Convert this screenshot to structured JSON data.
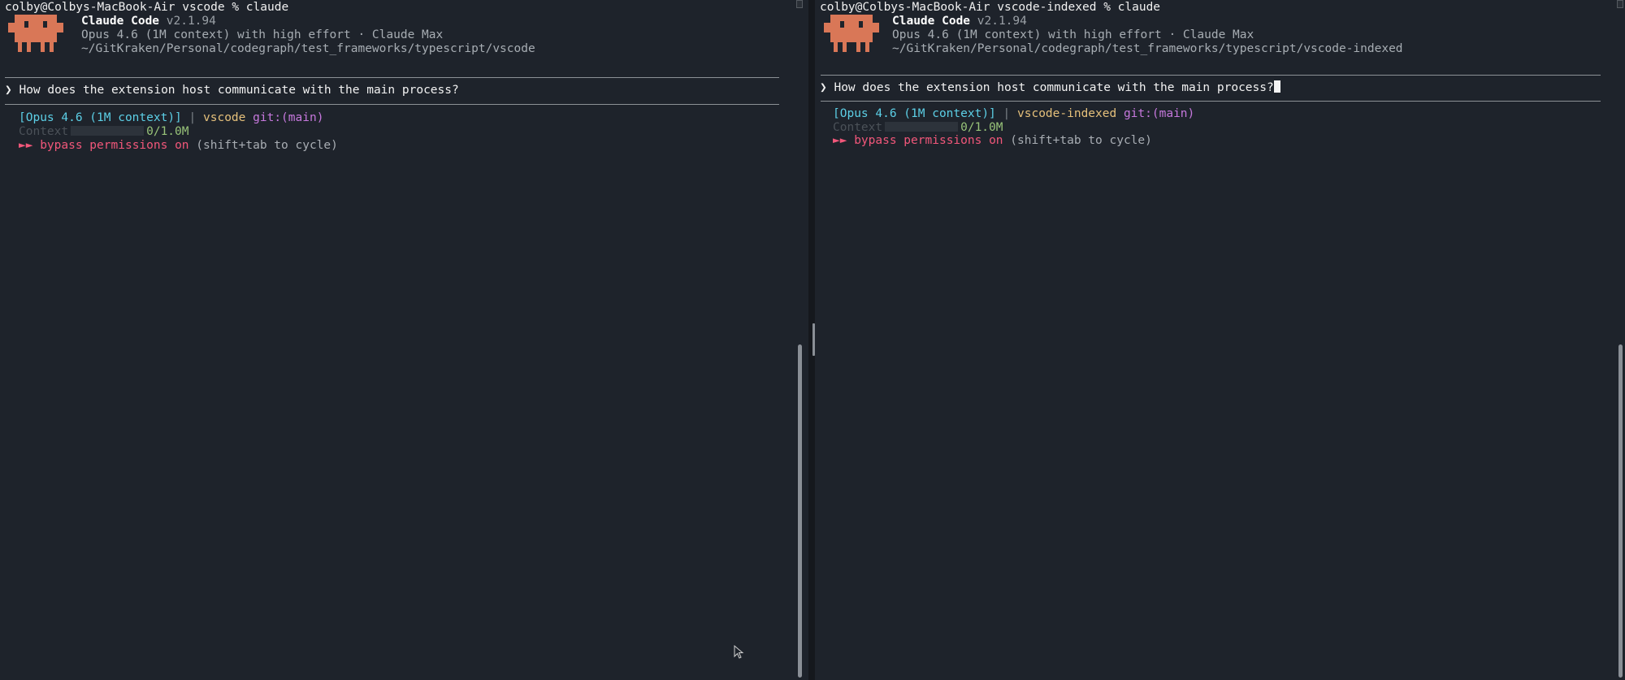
{
  "left_pane": {
    "shell_prompt": "colby@Colbys-MacBook-Air vscode % claude",
    "app_name": "Claude Code",
    "app_version": "v2.1.94",
    "model_line": "Opus 4.6 (1M context) with high effort · Claude Max",
    "path": "~/GitKraken/Personal/codegraph/test_frameworks/typescript/vscode",
    "input_caret": "❯",
    "input_text": "How does the extension host communicate with the main process?",
    "status": {
      "model": "[Opus 4.6 (1M context)]",
      "separator": "|",
      "repo": "vscode",
      "git_label": "git:",
      "branch": "(main)",
      "context_label": "Context",
      "context_value": "0/1.0M",
      "bypass_arrows": "►►",
      "bypass_text": "bypass permissions on",
      "bypass_hint": "(shift+tab to cycle)"
    }
  },
  "right_pane": {
    "shell_prompt": "colby@Colbys-MacBook-Air vscode-indexed % claude",
    "app_name": "Claude Code",
    "app_version": "v2.1.94",
    "model_line": "Opus 4.6 (1M context) with high effort · Claude Max",
    "path": "~/GitKraken/Personal/codegraph/test_frameworks/typescript/vscode-indexed",
    "input_caret": "❯",
    "input_text": "How does the extension host communicate with the main process?",
    "status": {
      "model": "[Opus 4.6 (1M context)]",
      "separator": "|",
      "repo": "vscode-indexed",
      "git_label": "git:",
      "branch": "(main)",
      "context_label": "Context",
      "context_value": "0/1.0M",
      "bypass_arrows": "►►",
      "bypass_text": "bypass permissions on",
      "bypass_hint": "(shift+tab to cycle)"
    }
  },
  "colors": {
    "background": "#1e232b",
    "mascot": "#d97757",
    "cyan": "#5ccfe6",
    "yellow": "#e5c07b",
    "magenta": "#c678dd",
    "green": "#98c379",
    "pink": "#f2577a"
  },
  "icons": {
    "mascot": "claude-mascot-icon",
    "input_caret": "chevron-right-icon",
    "bypass": "double-play-icon",
    "mouse": "mouse-pointer-icon"
  }
}
